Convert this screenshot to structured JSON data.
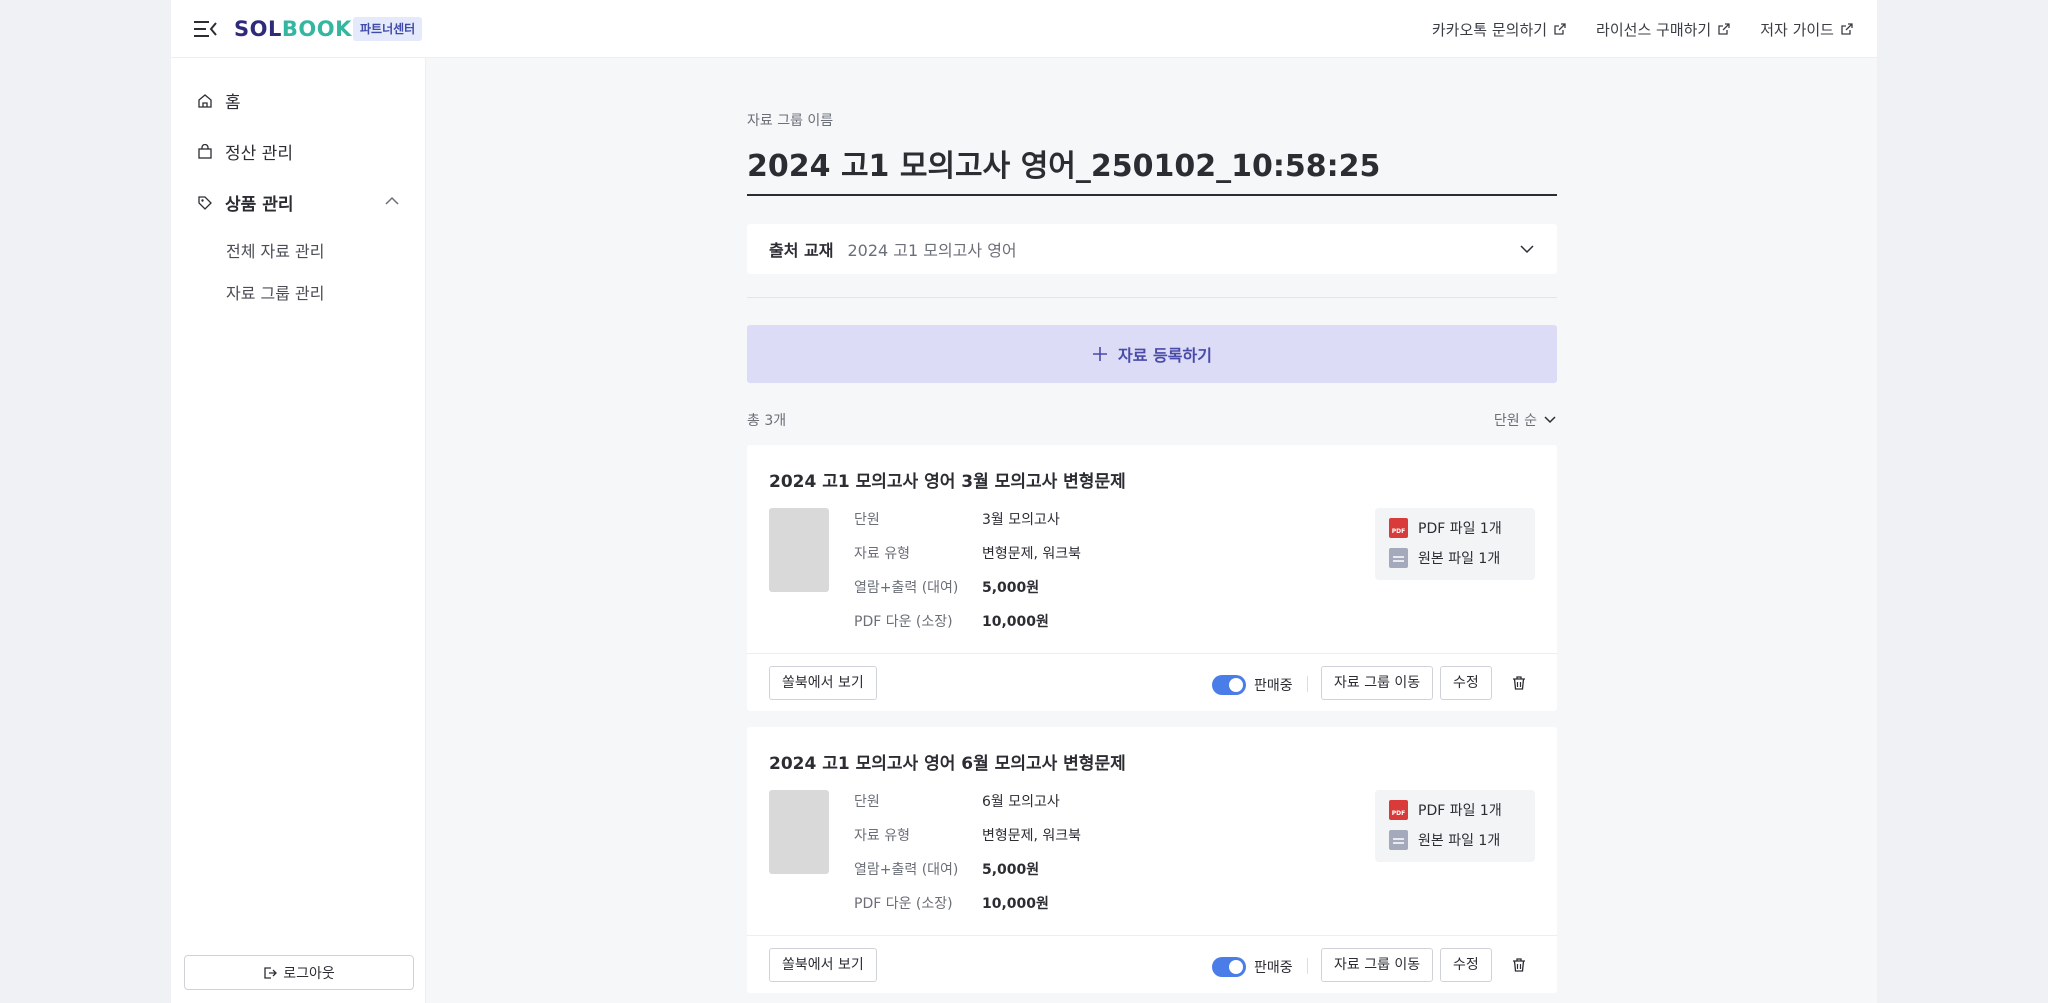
{
  "header": {
    "logo_part1": "SOL",
    "logo_part2": "BOOK",
    "badge": "파트너센터",
    "links": [
      {
        "label": "카카오톡 문의하기"
      },
      {
        "label": "라이선스 구매하기"
      },
      {
        "label": "저자 가이드"
      }
    ]
  },
  "sidebar": {
    "items": [
      {
        "label": "홈"
      },
      {
        "label": "정산 관리"
      },
      {
        "label": "상품 관리"
      }
    ],
    "sub_items": [
      {
        "label": "전체 자료 관리"
      },
      {
        "label": "자료 그룹 관리"
      }
    ],
    "logout": "로그아웃"
  },
  "main": {
    "group_label": "자료 그룹 이름",
    "group_title": "2024 고1 모의고사 영어_250102_10:58:25",
    "source_label": "출처 교재",
    "source_value": "2024 고1 모의고사 영어",
    "register_label": "자료 등록하기",
    "total_count": "총 3개",
    "sort_label": "단원 순",
    "cards": [
      {
        "title": "2024 고1 모의고사 영어 3월 모의고사 변형문제",
        "rows": [
          {
            "label": "단원",
            "value": "3월 모의고사"
          },
          {
            "label": "자료 유형",
            "value": "변형문제, 워크북"
          },
          {
            "label": "열람+출력 (대여)",
            "value": "5,000원"
          },
          {
            "label": "PDF 다운 (소장)",
            "value": "10,000원"
          }
        ],
        "files": {
          "pdf": "PDF 파일 1개",
          "original": "원본 파일 1개"
        },
        "view_label": "쏠북에서 보기",
        "status_label": "판매중",
        "on_sale": true,
        "move_label": "자료 그룹 이동",
        "edit_label": "수정"
      },
      {
        "title": "2024 고1 모의고사 영어 6월 모의고사 변형문제",
        "rows": [
          {
            "label": "단원",
            "value": "6월 모의고사"
          },
          {
            "label": "자료 유형",
            "value": "변형문제, 워크북"
          },
          {
            "label": "열람+출력 (대여)",
            "value": "5,000원"
          },
          {
            "label": "PDF 다운 (소장)",
            "value": "10,000원"
          }
        ],
        "files": {
          "pdf": "PDF 파일 1개",
          "original": "원본 파일 1개"
        },
        "view_label": "쏠북에서 보기",
        "status_label": "판매중",
        "on_sale": true,
        "move_label": "자료 그룹 이동",
        "edit_label": "수정"
      }
    ]
  },
  "icons": {
    "pdf_text": "PDF"
  },
  "colors": {
    "accent": "#4a7de8",
    "register_bg": "#dcdcf7",
    "logo_primary": "#2f2a7a",
    "logo_secondary": "#35b6a1",
    "pdf_red": "#d93a3a"
  }
}
